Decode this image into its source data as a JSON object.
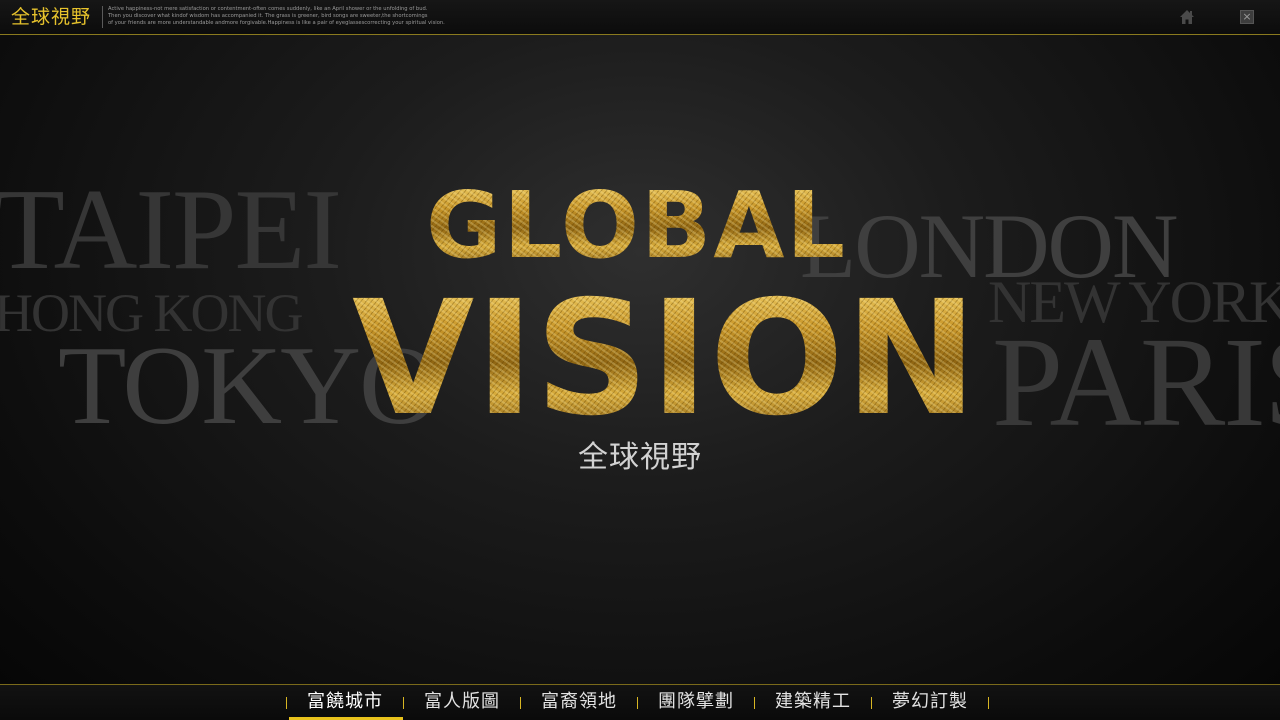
{
  "header": {
    "title": "全球視野",
    "blurb": [
      "Active happiness-not mere satisfaction or contentment-often comes suddenly, like an April shower or the unfolding of bud.",
      "Then you discover what kindof wisdom has accompanied it. The grass is greener, bird songs are sweeter,the shortcomings",
      "of your friends are more understandable andmore forgivable.Happiness is like a pair of eyeglassescorrecting your spiritual vision."
    ],
    "home_icon": "home-icon",
    "close_icon": "close-icon",
    "close_glyph": "×"
  },
  "hero": {
    "line1": "GLOBAL",
    "line2": "VISION",
    "subtitle": "全球視野",
    "cities": {
      "taipei": "TAIPEI",
      "hongkong": "HONG KONG",
      "tokyo": "TOKYO",
      "london": "LONDON",
      "newyork": "NEW YORK",
      "paris": "PARIS"
    }
  },
  "nav": {
    "items": [
      {
        "label": "富饒城市",
        "active": true
      },
      {
        "label": "富人版圖",
        "active": false
      },
      {
        "label": "富裔領地",
        "active": false
      },
      {
        "label": "團隊擘劃",
        "active": false
      },
      {
        "label": "建築精工",
        "active": false
      },
      {
        "label": "夢幻訂製",
        "active": false
      }
    ]
  },
  "colors": {
    "accent": "#e8c21c",
    "background": "#0b0b0b",
    "gold_light": "#f2d26a",
    "gold_dark": "#8f6512"
  }
}
